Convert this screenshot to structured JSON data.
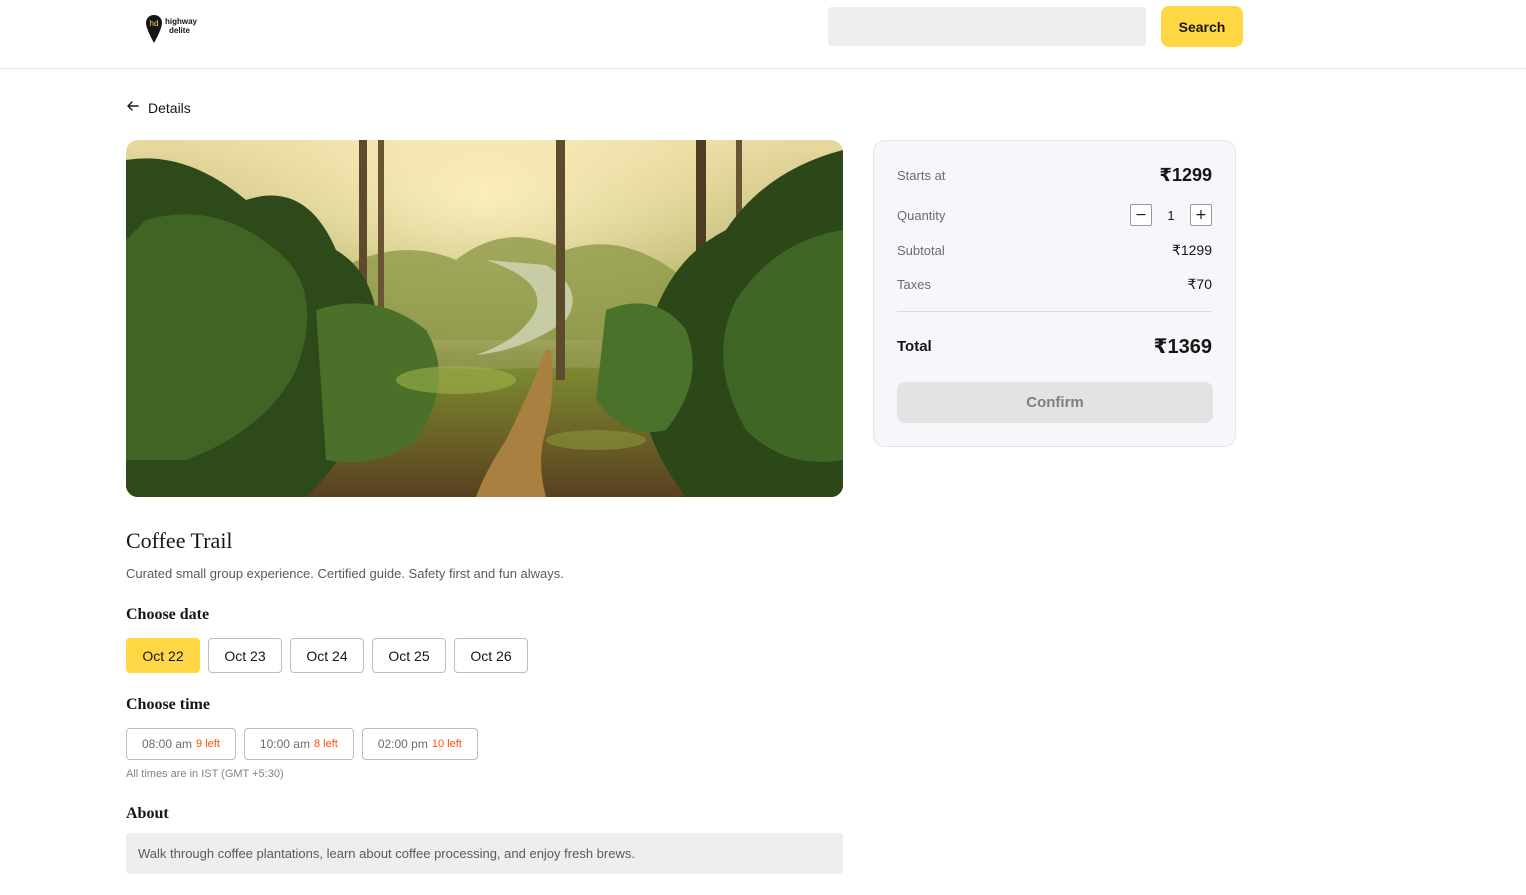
{
  "brand": {
    "name_line1": "highway",
    "name_line2": "delite",
    "monogram": "hd"
  },
  "search": {
    "placeholder": "",
    "button_label": "Search"
  },
  "nav": {
    "back_label": "Details"
  },
  "experience": {
    "title": "Coffee Trail",
    "description": "Curated small group experience. Certified guide. Safety first and fun always."
  },
  "dates": {
    "heading": "Choose date",
    "options": [
      "Oct 22",
      "Oct 23",
      "Oct 24",
      "Oct 25",
      "Oct 26"
    ],
    "selected": "Oct 22"
  },
  "times": {
    "heading": "Choose time",
    "options": [
      {
        "time": "08:00 am",
        "left": "9 left"
      },
      {
        "time": "10:00 am",
        "left": "8 left"
      },
      {
        "time": "02:00 pm",
        "left": "10 left"
      }
    ],
    "timezone_note": "All times are in IST (GMT +5:30)"
  },
  "about": {
    "heading": "About",
    "text": "Walk through coffee plantations, learn about coffee processing, and enjoy fresh brews."
  },
  "booking": {
    "starts_at_label": "Starts at",
    "starts_at_value": "₹1299",
    "quantity_label": "Quantity",
    "quantity_value": "1",
    "decrement": "−",
    "increment": "+",
    "subtotal_label": "Subtotal",
    "subtotal_value": "₹1299",
    "taxes_label": "Taxes",
    "taxes_value": "₹70",
    "total_label": "Total",
    "total_value": "₹1369",
    "confirm_label": "Confirm"
  },
  "colors": {
    "accent": "#ffd643",
    "seats_left": "#ff4c0a",
    "card_bg": "#f5f7fa",
    "disabled_button": "#e3e3e3"
  }
}
